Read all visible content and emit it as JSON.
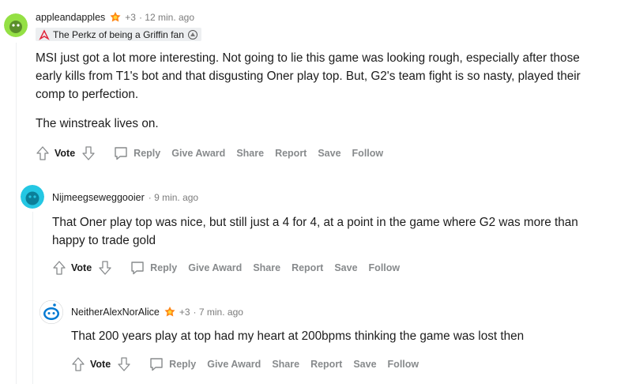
{
  "comments": [
    {
      "author": "appleandapples",
      "award_count": "+3",
      "time": "· 12 min. ago",
      "flair": "The Perkz of being a Griffin fan",
      "paragraphs": [
        "MSI just got a lot more interesting. Not going to lie this game was looking rough, especially after those early kills from T1's bot and that disgusting Oner play top. But, G2's team fight is so nasty, played their comp to perfection.",
        "The winstreak lives on."
      ],
      "actions": {
        "vote": "Vote",
        "reply": "Reply",
        "give_award": "Give Award",
        "share": "Share",
        "report": "Report",
        "save": "Save",
        "follow": "Follow"
      }
    },
    {
      "author": "Nijmeegseweggooier",
      "time": "· 9 min. ago",
      "paragraphs": [
        "That Oner play top was nice, but still just a 4 for 4, at a point in the game where G2 was more than happy to trade gold"
      ],
      "actions": {
        "vote": "Vote",
        "reply": "Reply",
        "give_award": "Give Award",
        "share": "Share",
        "report": "Report",
        "save": "Save",
        "follow": "Follow"
      }
    },
    {
      "author": "NeitherAlexNorAlice",
      "award_count": "+3",
      "time": "· 7 min. ago",
      "paragraphs": [
        "That 200 years play at top had my heart at 200bpms thinking the game was lost then"
      ],
      "actions": {
        "vote": "Vote",
        "reply": "Reply",
        "give_award": "Give Award",
        "share": "Share",
        "report": "Report",
        "save": "Save",
        "follow": "Follow"
      }
    }
  ],
  "colors": {
    "accent_award": "#ff8717",
    "thread_line": "#edeff1",
    "muted": "#878a8c"
  }
}
